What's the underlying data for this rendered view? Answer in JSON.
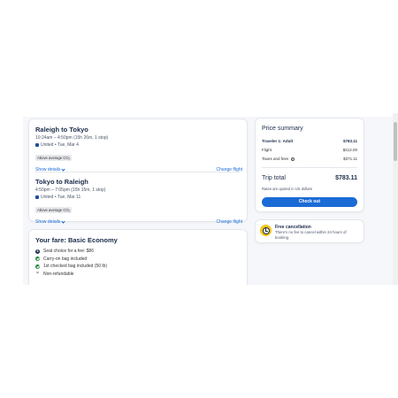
{
  "flights": {
    "legs": [
      {
        "route": "Raleigh to Tokyo",
        "time": "10:24am – 4:50pm (15h 26m, 1 stop)",
        "airline_date": "United • Tue, Mar 4",
        "emissions": "Above average CO₂",
        "show_details": "Show details",
        "change_flight": "Change flight"
      },
      {
        "route": "Tokyo to Raleigh",
        "time": "4:50pm – 7:05pm (15h 15m, 1 stop)",
        "airline_date": "United • Tue, Mar 11",
        "emissions": "Above average CO₂",
        "show_details": "Show details",
        "change_flight": "Change flight"
      }
    ]
  },
  "fare": {
    "title": "Your fare: Basic Economy",
    "items": [
      {
        "icon": "dollar-icon",
        "text": "Seat choice for a fee: $86"
      },
      {
        "icon": "check-icon",
        "text": "Carry-on bag included"
      },
      {
        "icon": "check-icon",
        "text": "1st checked bag included (50 lb)"
      },
      {
        "icon": "x-icon",
        "text": "Non-refundable"
      }
    ]
  },
  "price_summary": {
    "title": "Price summary",
    "traveler_label": "Traveler 1: Adult",
    "traveler_amount": "$783.11",
    "flight_label": "Flight",
    "flight_amount": "$412.00",
    "taxes_label": "Taxes and fees",
    "taxes_amount": "$371.11",
    "total_label": "Trip total",
    "total_amount": "$783.11",
    "rates_note": "Rates are quoted in US dollars",
    "checkout_label": "Check out"
  },
  "free_cancellation": {
    "title": "Free cancellation",
    "text": "There's no fee to cancel within 24 hours of booking."
  },
  "colors": {
    "accent": "#1b6bd6",
    "text_primary": "#1a2b49",
    "check": "#2a8a3e",
    "cancel_icon": "#f5c518"
  }
}
